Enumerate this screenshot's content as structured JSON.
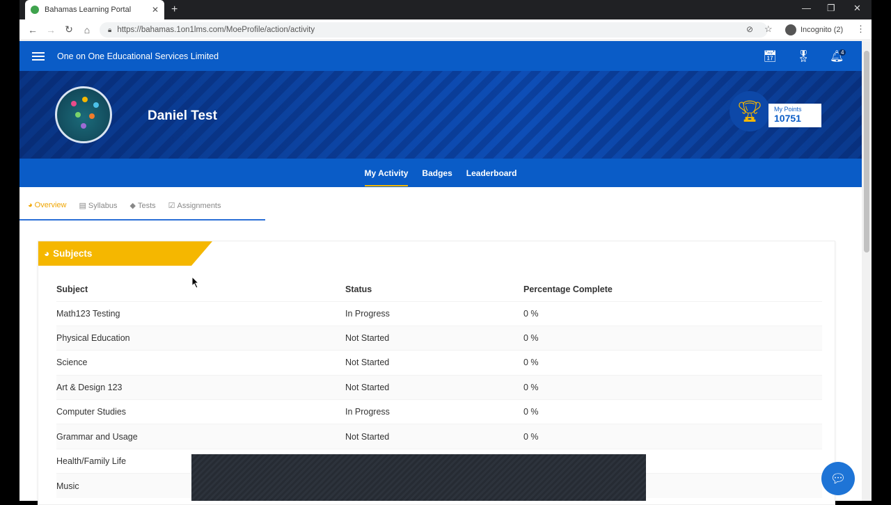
{
  "browser": {
    "tab_title": "Bahamas Learning Portal",
    "url": "https://bahamas.1on1lms.com/MoeProfile/action/activity",
    "incognito_label": "Incognito (2)"
  },
  "header": {
    "org_name": "One on One Educational Services Limited",
    "notification_count": "4"
  },
  "profile": {
    "name": "Daniel Test",
    "points_label": "My Points",
    "points_value": "10751"
  },
  "subnav": {
    "items": [
      "My Activity",
      "Badges",
      "Leaderboard"
    ]
  },
  "innertabs": {
    "items": [
      "Overview",
      "Syllabus",
      "Tests",
      "Assignments"
    ]
  },
  "subjects": {
    "title": "Subjects",
    "columns": [
      "Subject",
      "Status",
      "Percentage Complete"
    ],
    "rows": [
      {
        "subject": "Math123 Testing",
        "status": "In Progress",
        "pct": "0 %"
      },
      {
        "subject": "Physical Education",
        "status": "Not Started",
        "pct": "0 %"
      },
      {
        "subject": "Science",
        "status": "Not Started",
        "pct": "0 %"
      },
      {
        "subject": "Art & Design 123",
        "status": "Not Started",
        "pct": "0 %"
      },
      {
        "subject": "Computer Studies",
        "status": "In Progress",
        "pct": "0 %"
      },
      {
        "subject": "Grammar and Usage",
        "status": "Not Started",
        "pct": "0 %"
      },
      {
        "subject": "Health/Family Life",
        "status": "",
        "pct": ""
      },
      {
        "subject": "Music",
        "status": "",
        "pct": ""
      }
    ]
  },
  "colors": {
    "primary": "#0a5cc7",
    "accent": "#f5b700"
  }
}
